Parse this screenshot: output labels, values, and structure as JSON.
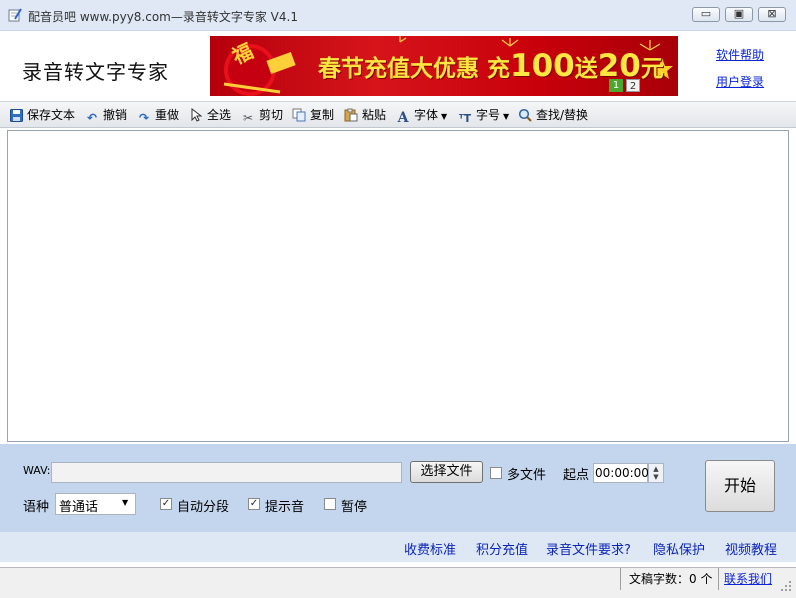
{
  "window": {
    "title": "配音员吧 www.pyy8.com—录音转文字专家 V4.1",
    "minimize_glyph": "▭",
    "maximize_glyph": "▣",
    "close_glyph": "⊠"
  },
  "header": {
    "brand": "录音转文字专家",
    "banner": {
      "text_main": "春节充值大优惠  充",
      "text_big1": "100",
      "text_mid": "送",
      "text_big2": "20",
      "text_end": "元",
      "fu_char": "福",
      "pages": [
        "1",
        "2"
      ]
    },
    "links": {
      "help": "软件帮助",
      "login": "用户登录"
    }
  },
  "toolbar": {
    "items": [
      {
        "label": "保存文本",
        "icon": "save-icon"
      },
      {
        "label": "撤销",
        "icon": "undo-icon"
      },
      {
        "label": "重做",
        "icon": "redo-icon"
      },
      {
        "label": "全选",
        "icon": "cursor-icon"
      },
      {
        "label": "剪切",
        "icon": "scissors-icon"
      },
      {
        "label": "复制",
        "icon": "copy-icon"
      },
      {
        "label": "粘贴",
        "icon": "paste-icon"
      },
      {
        "label": "字体",
        "icon": "font-icon"
      },
      {
        "label": "字号",
        "icon": "font-size-icon"
      },
      {
        "label": "查找/替换",
        "icon": "magnifier-icon"
      }
    ]
  },
  "editor": {
    "value": ""
  },
  "panel": {
    "wav_label": "WAV:",
    "wav_value": "",
    "choose_file_label": "选择文件",
    "multi_file_label": "多文件",
    "multi_file_checked": false,
    "start_point_label": "起点",
    "start_time": "00:00:00",
    "language_label": "语种",
    "language_value": "普通话",
    "auto_segment_label": "自动分段",
    "auto_segment_checked": true,
    "prompt_sound_label": "提示音",
    "prompt_sound_checked": true,
    "pause_label": "暂停",
    "pause_checked": false,
    "start_button_label": "开始",
    "check_mark": "✓"
  },
  "bottom_links": [
    "收费标准",
    "积分充值",
    "录音文件要求?",
    "隐私保护",
    "视频教程"
  ],
  "statusbar": {
    "word_count": "文稿字数：0 个",
    "contact": "联系我们"
  },
  "colors": {
    "title_bar": "#dfe8f4",
    "panel": "#c4d6ed",
    "link": "#0b24d6",
    "banner_red": "#c8000a",
    "banner_yellow": "#ffe640"
  }
}
